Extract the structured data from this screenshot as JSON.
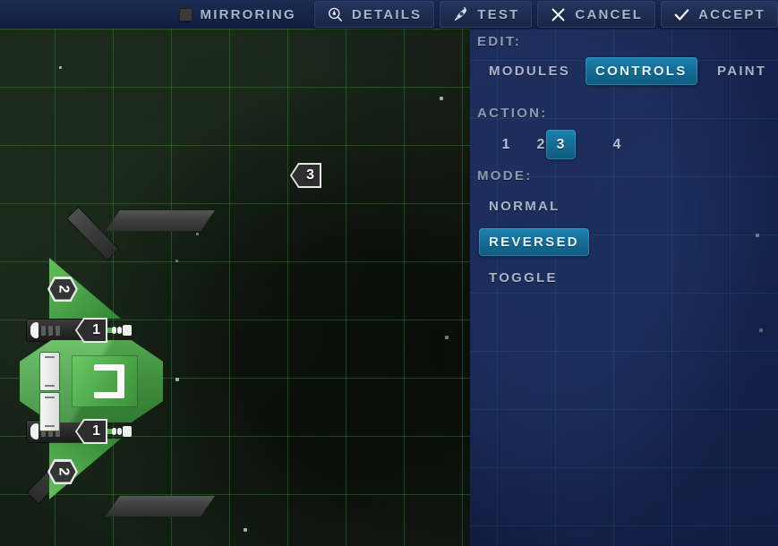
{
  "toolbar": {
    "mirroring": {
      "label": "MIRRORING",
      "checked": false,
      "icon": "checkbox-icon"
    },
    "details": {
      "label": "DETAILS",
      "icon": "magnifier-icon"
    },
    "test": {
      "label": "TEST",
      "icon": "rocket-icon"
    },
    "cancel": {
      "label": "CANCEL",
      "icon": "x-icon"
    },
    "accept": {
      "label": "ACCEPT",
      "icon": "check-icon"
    }
  },
  "panel": {
    "edit": {
      "label": "EDIT:",
      "options": [
        "MODULES",
        "CONTROLS",
        "PAINT"
      ],
      "selected": "CONTROLS"
    },
    "action": {
      "label": "ACTION:",
      "options": [
        "1",
        "2",
        "3",
        "4"
      ],
      "selected": "3"
    },
    "mode": {
      "label": "MODE:",
      "options": [
        "NORMAL",
        "REVERSED",
        "TOGGLE"
      ],
      "selected": "REVERSED"
    }
  },
  "canvas": {
    "markers": [
      {
        "name": "free-tag-3",
        "value": "3",
        "kind": "arrow-tag"
      },
      {
        "name": "top-thruster-tag",
        "value": "1",
        "kind": "arrow-tag"
      },
      {
        "name": "bottom-thruster-tag",
        "value": "1",
        "kind": "arrow-tag"
      },
      {
        "name": "top-wing-badge",
        "value": "2",
        "kind": "hex-badge"
      },
      {
        "name": "bottom-wing-badge",
        "value": "2",
        "kind": "hex-badge"
      }
    ]
  },
  "colors": {
    "accent": "#146e97",
    "toolbar_bg": "#16244a",
    "panel_bg": "#13204a",
    "canvas_bg": "#141d14",
    "grid_green": "#3c963c",
    "hull_green": "#48a246",
    "text_muted": "#8e9ab1",
    "text_light": "#a9b4c9",
    "text_selected": "#e8f6ff"
  }
}
